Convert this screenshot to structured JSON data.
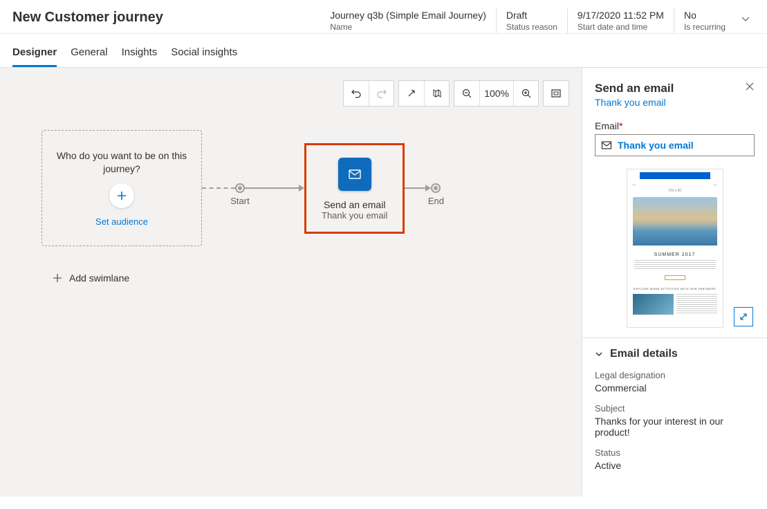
{
  "header": {
    "title": "New Customer journey",
    "fields": {
      "name": {
        "value": "Journey q3b (Simple Email Journey)",
        "label": "Name"
      },
      "status": {
        "value": "Draft",
        "label": "Status reason"
      },
      "start": {
        "value": "9/17/2020 11:52 PM",
        "label": "Start date and time"
      },
      "recurring": {
        "value": "No",
        "label": "Is recurring"
      }
    }
  },
  "tabs": [
    "Designer",
    "General",
    "Insights",
    "Social insights"
  ],
  "toolbar": {
    "zoom": "100%"
  },
  "canvas": {
    "audience": {
      "prompt": "Who do you want to be on this journey?",
      "action": "Set audience"
    },
    "start_label": "Start",
    "end_label": "End",
    "email_tile": {
      "title": "Send an email",
      "subtitle": "Thank you email"
    },
    "add_swimlane": "Add swimlane"
  },
  "side": {
    "title": "Send an email",
    "link": "Thank you email",
    "email_field": {
      "label": "Email",
      "value": "Thank you email"
    },
    "preview": {
      "headline": "SUMMER 2017",
      "footer_line": "EXPLORE MORE ACTIVITIES WITH OUR PARTNERS"
    },
    "details": {
      "section_title": "Email details",
      "legal": {
        "label": "Legal designation",
        "value": "Commercial"
      },
      "subject": {
        "label": "Subject",
        "value": "Thanks for your interest in our product!"
      },
      "status": {
        "label": "Status",
        "value": "Active"
      }
    }
  }
}
